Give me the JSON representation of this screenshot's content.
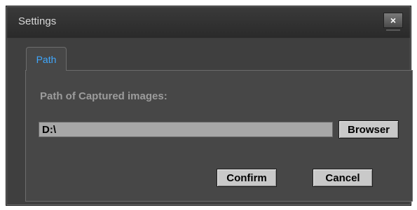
{
  "window": {
    "title": "Settings",
    "close_symbol": "×"
  },
  "tabs": [
    {
      "label": "Path",
      "active": true
    }
  ],
  "path_section": {
    "label": "Path of Captured images:",
    "value": "D:\\",
    "browse_label": "Browser"
  },
  "footer": {
    "confirm_label": "Confirm",
    "cancel_label": "Cancel"
  },
  "colors": {
    "background": "#3f3f3f",
    "tab_text": "#3fa8ff",
    "button_face": "#c9c9c9",
    "input_background": "#a7a7a7"
  }
}
